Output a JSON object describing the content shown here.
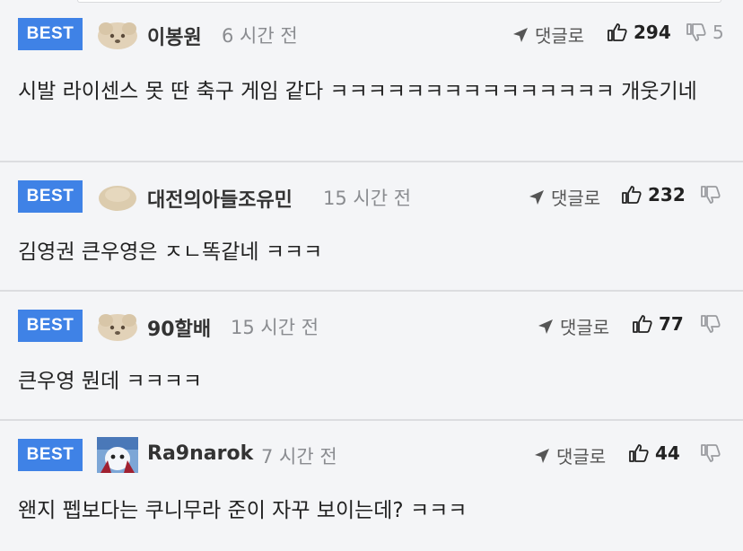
{
  "reply_label": "댓글로",
  "best_label": "BEST",
  "comments": [
    {
      "username": "이봉원",
      "time": "6 시간 전",
      "likes": "294",
      "dislikes": "5",
      "text": "시발 라이센스 못 딴 축구 게임 같다 ㅋㅋㅋㅋㅋㅋㅋㅋㅋㅋㅋㅋㅋㅋㅋ 개웃기네",
      "avatar": "puppy-avatar"
    },
    {
      "username": "대전의아들조유민",
      "time": "15 시간 전",
      "likes": "232",
      "dislikes": "",
      "text": "김영권 큰우영은 ㅈㄴ똑같네 ㅋㅋㅋ",
      "avatar": "blob-avatar"
    },
    {
      "username": "90할배",
      "time": "15 시간 전",
      "likes": "77",
      "dislikes": "",
      "text": "큰우영 뭔데 ㅋㅋㅋㅋ",
      "avatar": "puppy-avatar"
    },
    {
      "username": "Ra9narok",
      "time": "7 시간 전",
      "likes": "44",
      "dislikes": "",
      "text": "왠지 펩보다는 쿠니무라 준이 자꾸 보이는데? ㅋㅋㅋ",
      "avatar": "ghost-avatar"
    }
  ],
  "colors": {
    "best_badge": "#3f82e6",
    "background": "#f4f5f7",
    "divider": "#dcdde0"
  }
}
